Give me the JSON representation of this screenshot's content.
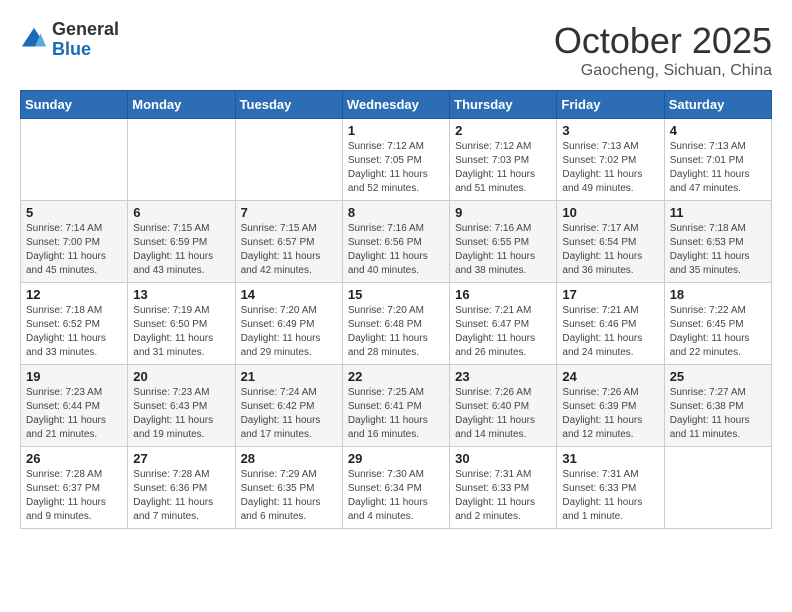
{
  "logo": {
    "general": "General",
    "blue": "Blue"
  },
  "header": {
    "month": "October 2025",
    "location": "Gaocheng, Sichuan, China"
  },
  "weekdays": [
    "Sunday",
    "Monday",
    "Tuesday",
    "Wednesday",
    "Thursday",
    "Friday",
    "Saturday"
  ],
  "weeks": [
    [
      {
        "day": "",
        "info": ""
      },
      {
        "day": "",
        "info": ""
      },
      {
        "day": "",
        "info": ""
      },
      {
        "day": "1",
        "sunrise": "Sunrise: 7:12 AM",
        "sunset": "Sunset: 7:05 PM",
        "daylight": "Daylight: 11 hours and 52 minutes."
      },
      {
        "day": "2",
        "sunrise": "Sunrise: 7:12 AM",
        "sunset": "Sunset: 7:03 PM",
        "daylight": "Daylight: 11 hours and 51 minutes."
      },
      {
        "day": "3",
        "sunrise": "Sunrise: 7:13 AM",
        "sunset": "Sunset: 7:02 PM",
        "daylight": "Daylight: 11 hours and 49 minutes."
      },
      {
        "day": "4",
        "sunrise": "Sunrise: 7:13 AM",
        "sunset": "Sunset: 7:01 PM",
        "daylight": "Daylight: 11 hours and 47 minutes."
      }
    ],
    [
      {
        "day": "5",
        "sunrise": "Sunrise: 7:14 AM",
        "sunset": "Sunset: 7:00 PM",
        "daylight": "Daylight: 11 hours and 45 minutes."
      },
      {
        "day": "6",
        "sunrise": "Sunrise: 7:15 AM",
        "sunset": "Sunset: 6:59 PM",
        "daylight": "Daylight: 11 hours and 43 minutes."
      },
      {
        "day": "7",
        "sunrise": "Sunrise: 7:15 AM",
        "sunset": "Sunset: 6:57 PM",
        "daylight": "Daylight: 11 hours and 42 minutes."
      },
      {
        "day": "8",
        "sunrise": "Sunrise: 7:16 AM",
        "sunset": "Sunset: 6:56 PM",
        "daylight": "Daylight: 11 hours and 40 minutes."
      },
      {
        "day": "9",
        "sunrise": "Sunrise: 7:16 AM",
        "sunset": "Sunset: 6:55 PM",
        "daylight": "Daylight: 11 hours and 38 minutes."
      },
      {
        "day": "10",
        "sunrise": "Sunrise: 7:17 AM",
        "sunset": "Sunset: 6:54 PM",
        "daylight": "Daylight: 11 hours and 36 minutes."
      },
      {
        "day": "11",
        "sunrise": "Sunrise: 7:18 AM",
        "sunset": "Sunset: 6:53 PM",
        "daylight": "Daylight: 11 hours and 35 minutes."
      }
    ],
    [
      {
        "day": "12",
        "sunrise": "Sunrise: 7:18 AM",
        "sunset": "Sunset: 6:52 PM",
        "daylight": "Daylight: 11 hours and 33 minutes."
      },
      {
        "day": "13",
        "sunrise": "Sunrise: 7:19 AM",
        "sunset": "Sunset: 6:50 PM",
        "daylight": "Daylight: 11 hours and 31 minutes."
      },
      {
        "day": "14",
        "sunrise": "Sunrise: 7:20 AM",
        "sunset": "Sunset: 6:49 PM",
        "daylight": "Daylight: 11 hours and 29 minutes."
      },
      {
        "day": "15",
        "sunrise": "Sunrise: 7:20 AM",
        "sunset": "Sunset: 6:48 PM",
        "daylight": "Daylight: 11 hours and 28 minutes."
      },
      {
        "day": "16",
        "sunrise": "Sunrise: 7:21 AM",
        "sunset": "Sunset: 6:47 PM",
        "daylight": "Daylight: 11 hours and 26 minutes."
      },
      {
        "day": "17",
        "sunrise": "Sunrise: 7:21 AM",
        "sunset": "Sunset: 6:46 PM",
        "daylight": "Daylight: 11 hours and 24 minutes."
      },
      {
        "day": "18",
        "sunrise": "Sunrise: 7:22 AM",
        "sunset": "Sunset: 6:45 PM",
        "daylight": "Daylight: 11 hours and 22 minutes."
      }
    ],
    [
      {
        "day": "19",
        "sunrise": "Sunrise: 7:23 AM",
        "sunset": "Sunset: 6:44 PM",
        "daylight": "Daylight: 11 hours and 21 minutes."
      },
      {
        "day": "20",
        "sunrise": "Sunrise: 7:23 AM",
        "sunset": "Sunset: 6:43 PM",
        "daylight": "Daylight: 11 hours and 19 minutes."
      },
      {
        "day": "21",
        "sunrise": "Sunrise: 7:24 AM",
        "sunset": "Sunset: 6:42 PM",
        "daylight": "Daylight: 11 hours and 17 minutes."
      },
      {
        "day": "22",
        "sunrise": "Sunrise: 7:25 AM",
        "sunset": "Sunset: 6:41 PM",
        "daylight": "Daylight: 11 hours and 16 minutes."
      },
      {
        "day": "23",
        "sunrise": "Sunrise: 7:26 AM",
        "sunset": "Sunset: 6:40 PM",
        "daylight": "Daylight: 11 hours and 14 minutes."
      },
      {
        "day": "24",
        "sunrise": "Sunrise: 7:26 AM",
        "sunset": "Sunset: 6:39 PM",
        "daylight": "Daylight: 11 hours and 12 minutes."
      },
      {
        "day": "25",
        "sunrise": "Sunrise: 7:27 AM",
        "sunset": "Sunset: 6:38 PM",
        "daylight": "Daylight: 11 hours and 11 minutes."
      }
    ],
    [
      {
        "day": "26",
        "sunrise": "Sunrise: 7:28 AM",
        "sunset": "Sunset: 6:37 PM",
        "daylight": "Daylight: 11 hours and 9 minutes."
      },
      {
        "day": "27",
        "sunrise": "Sunrise: 7:28 AM",
        "sunset": "Sunset: 6:36 PM",
        "daylight": "Daylight: 11 hours and 7 minutes."
      },
      {
        "day": "28",
        "sunrise": "Sunrise: 7:29 AM",
        "sunset": "Sunset: 6:35 PM",
        "daylight": "Daylight: 11 hours and 6 minutes."
      },
      {
        "day": "29",
        "sunrise": "Sunrise: 7:30 AM",
        "sunset": "Sunset: 6:34 PM",
        "daylight": "Daylight: 11 hours and 4 minutes."
      },
      {
        "day": "30",
        "sunrise": "Sunrise: 7:31 AM",
        "sunset": "Sunset: 6:33 PM",
        "daylight": "Daylight: 11 hours and 2 minutes."
      },
      {
        "day": "31",
        "sunrise": "Sunrise: 7:31 AM",
        "sunset": "Sunset: 6:33 PM",
        "daylight": "Daylight: 11 hours and 1 minute."
      },
      {
        "day": "",
        "info": ""
      }
    ]
  ]
}
